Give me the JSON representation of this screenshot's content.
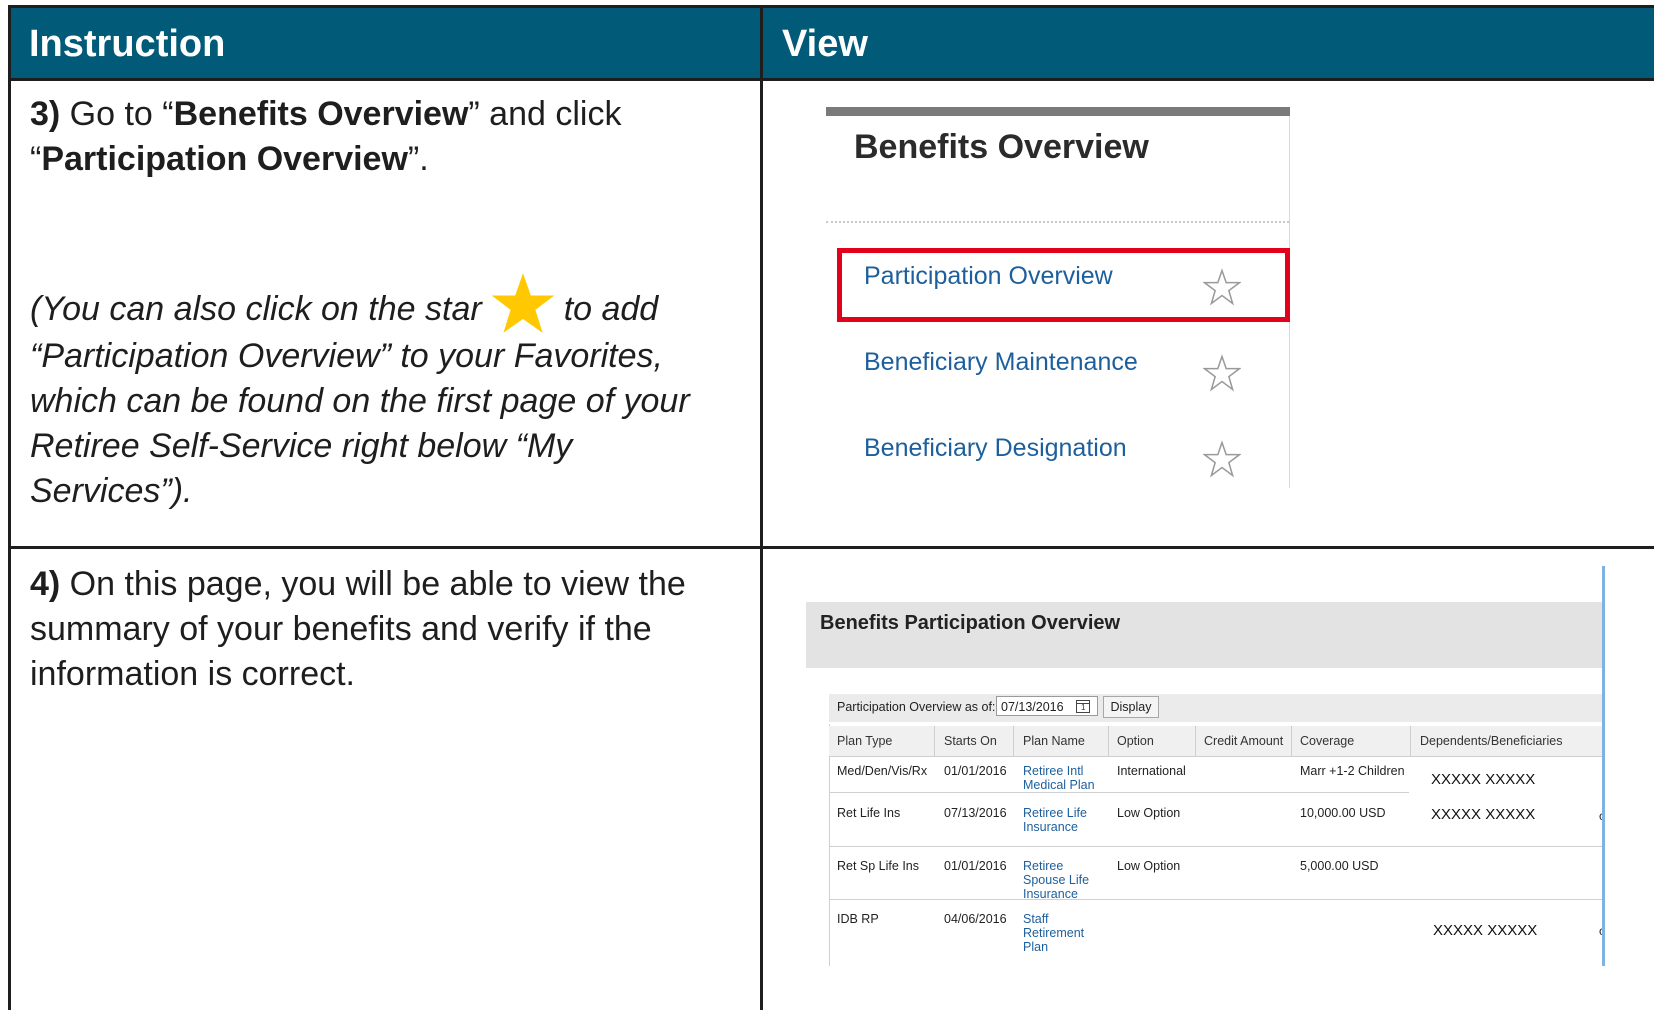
{
  "header": {
    "instruction": "Instruction",
    "view": "View"
  },
  "step3": {
    "num": "3)",
    "t1": " Go to “",
    "b1": "Benefits Overview",
    "t2": "” and click “",
    "b2": "Participation Overview",
    "t3": "”.",
    "note_before_star": "(You can also click on the star",
    "note_after_star": "to add “Participation Overview” to your Favorites, which can be found on the first page of your Retiree Self-Service right below “My Services”)."
  },
  "step4": {
    "num": "4)",
    "text": " On this page, you will be able to view the summary of your benefits and verify if the information is correct."
  },
  "benefits_overview": {
    "title": "Benefits Overview",
    "items": [
      {
        "label": "Participation Overview",
        "icon": "star-outline-icon",
        "highlighted": true
      },
      {
        "label": "Beneficiary Maintenance",
        "icon": "star-outline-icon"
      },
      {
        "label": "Beneficiary Designation",
        "icon": "star-outline-icon"
      }
    ],
    "highlight_color": "#e3001b"
  },
  "participation": {
    "title": "Benefits Participation Overview",
    "filter_label": "Participation Overview as of:",
    "date": "07/13/2016",
    "calendar_day": "1",
    "display_button": "Display",
    "columns": [
      "Plan Type",
      "Starts On",
      "Plan Name",
      "Option",
      "Credit Amount",
      "Coverage",
      "Dependents/Beneficiaries"
    ],
    "rows": [
      {
        "plan_type": "Med/Den/Vis/Rx",
        "starts_on": "01/01/2016",
        "plan_name": [
          "Retiree Intl",
          "Medical Plan"
        ],
        "option": "International",
        "credit": "",
        "coverage": "Marr +1-2 Children",
        "dependents": "XXXXX XXXXX",
        "trunc": ""
      },
      {
        "plan_type": "Ret Life Ins",
        "starts_on": "07/13/2016",
        "plan_name": [
          "Retiree Life",
          "Insurance"
        ],
        "option": "Low Option",
        "credit": "",
        "coverage": "10,000.00 USD",
        "dependents": "XXXXX XXXXX",
        "trunc": "c"
      },
      {
        "plan_type": "Ret Sp Life Ins",
        "starts_on": "01/01/2016",
        "plan_name": [
          "Retiree",
          "Spouse Life",
          "Insurance"
        ],
        "option": "Low Option",
        "credit": "",
        "coverage": "5,000.00 USD",
        "dependents": "",
        "trunc": ""
      },
      {
        "plan_type": "IDB RP",
        "starts_on": "04/06/2016",
        "plan_name": [
          "Staff",
          "Retirement",
          "Plan"
        ],
        "option": "",
        "credit": "",
        "coverage": "",
        "dependents": "XXXXX XXXXX",
        "trunc": "c"
      }
    ]
  },
  "colors": {
    "header_bg": "#005a78",
    "link": "#1d5f9c",
    "star": "#ffc800"
  }
}
